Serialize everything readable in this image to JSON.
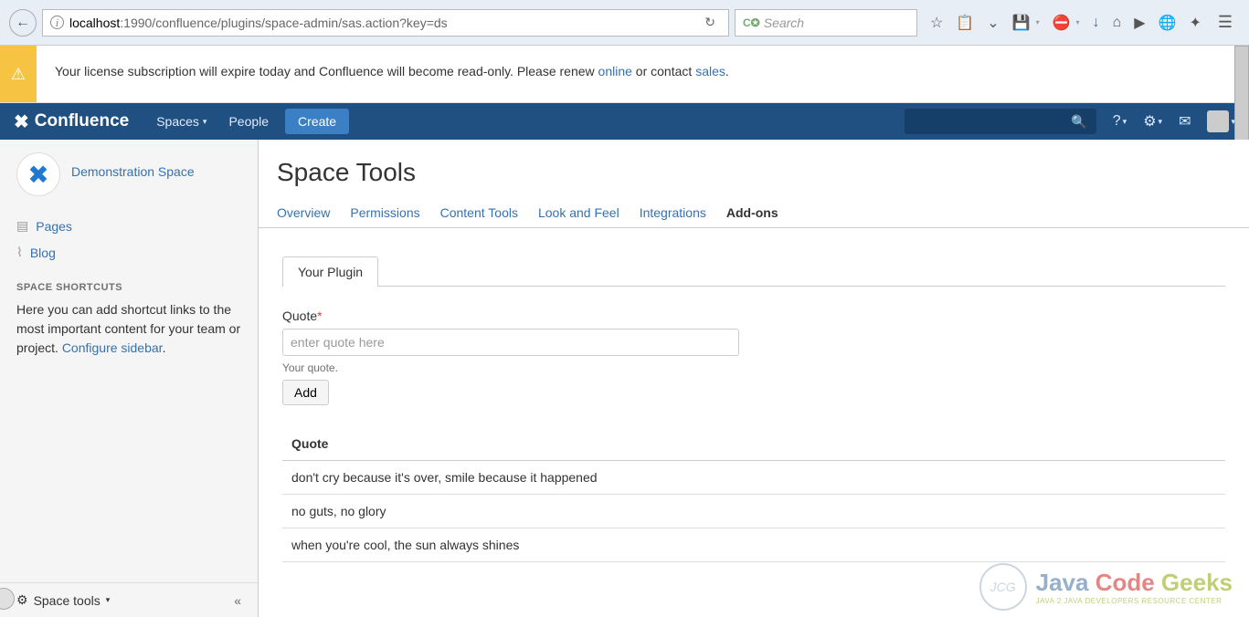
{
  "browser": {
    "url_host": "localhost",
    "url_path": ":1990/confluence/plugins/space-admin/sas.action?key=ds",
    "search_placeholder": "Search"
  },
  "warning": {
    "prefix": "Your license subscription will expire today and Confluence will become read-only. Please renew ",
    "link1": "online",
    "middle": " or contact ",
    "link2": "sales",
    "suffix": "."
  },
  "header": {
    "logo": "Confluence",
    "nav_spaces": "Spaces",
    "nav_people": "People",
    "create": "Create"
  },
  "sidebar": {
    "space_name": "Demonstration Space",
    "pages": "Pages",
    "blog": "Blog",
    "shortcuts_title": "SPACE SHORTCUTS",
    "shortcuts_help_prefix": "Here you can add shortcut links to the most important content for your team or project. ",
    "shortcuts_help_link": "Configure sidebar",
    "shortcuts_help_suffix": ".",
    "space_tools": "Space tools"
  },
  "page": {
    "title": "Space Tools",
    "tabs": [
      "Overview",
      "Permissions",
      "Content Tools",
      "Look and Feel",
      "Integrations",
      "Add-ons"
    ],
    "active_tab": "Add-ons"
  },
  "plugin": {
    "subtab": "Your Plugin",
    "field_label": "Quote",
    "placeholder": "enter quote here",
    "field_desc": "Your quote.",
    "add_button": "Add",
    "table_header": "Quote",
    "quotes": [
      "don't cry because it's over, smile because it happened",
      "no guts, no glory",
      "when you're cool, the sun always shines"
    ]
  },
  "watermark": {
    "circle": "JCG",
    "main_j": "Java ",
    "main_c": "Code ",
    "main_g": "Geeks",
    "sub": "JAVA 2 JAVA DEVELOPERS RESOURCE CENTER"
  }
}
